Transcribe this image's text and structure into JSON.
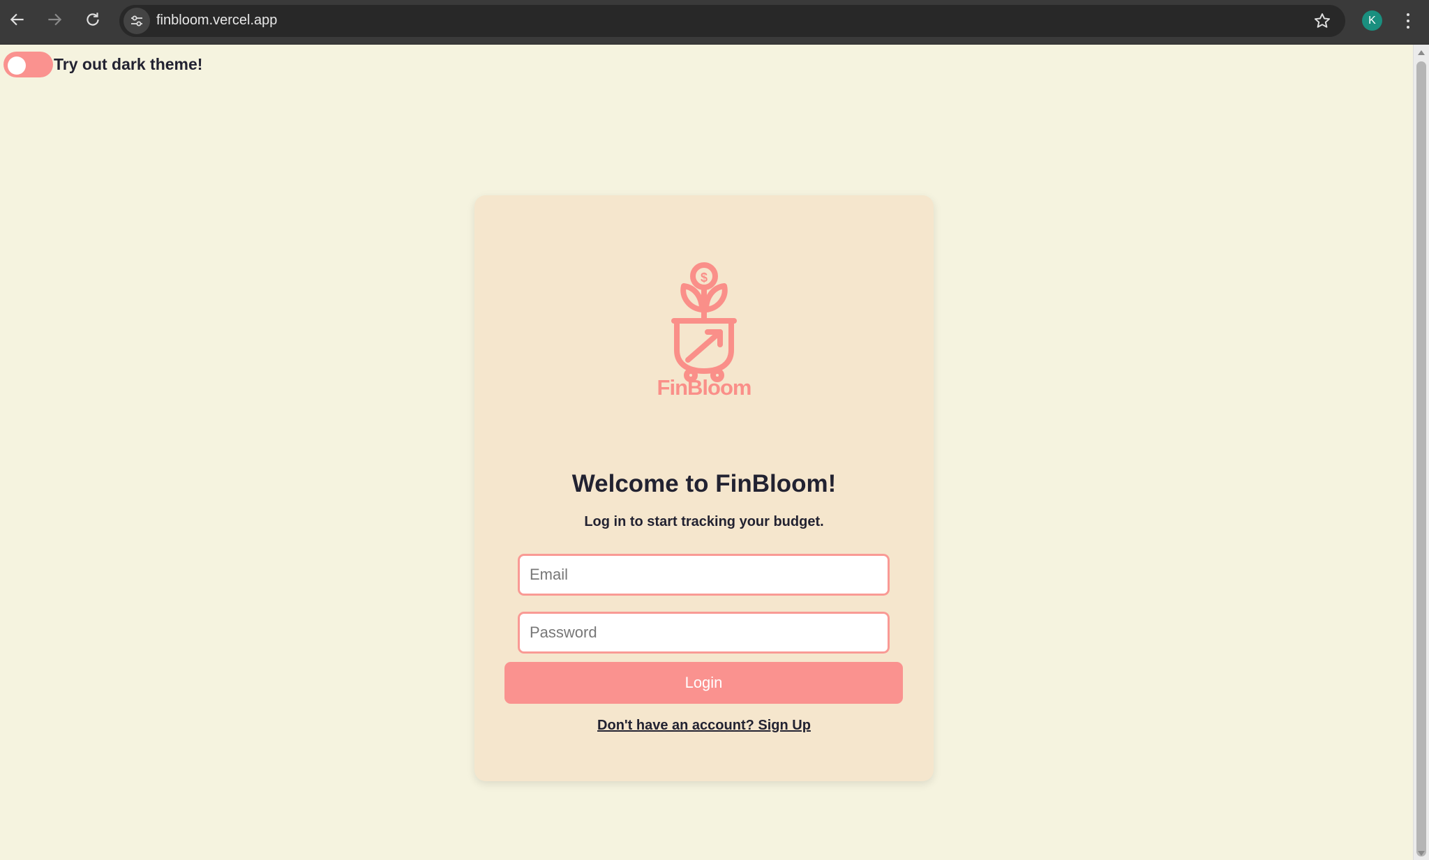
{
  "browser": {
    "url": "finbloom.vercel.app",
    "profile_initial": "K",
    "icons": {
      "back": "back-arrow-icon",
      "forward": "forward-arrow-icon",
      "reload": "reload-icon",
      "site_info": "tune-icon",
      "bookmark": "star-icon",
      "menu": "kebab-menu-icon"
    }
  },
  "theme_toggle": {
    "label": "Try out dark theme!",
    "enabled": false
  },
  "login_card": {
    "logo_text": "FinBloom",
    "title": "Welcome to FinBloom!",
    "subtitle": "Log in to start tracking your budget.",
    "email_placeholder": "Email",
    "email_value": "",
    "password_placeholder": "Password",
    "password_value": "",
    "login_label": "Login",
    "signup_link": "Don't have an account? Sign Up"
  },
  "colors": {
    "page_background": "#f5f3df",
    "card_background": "#f5e6cd",
    "accent": "#fa928f",
    "text": "#222231"
  }
}
